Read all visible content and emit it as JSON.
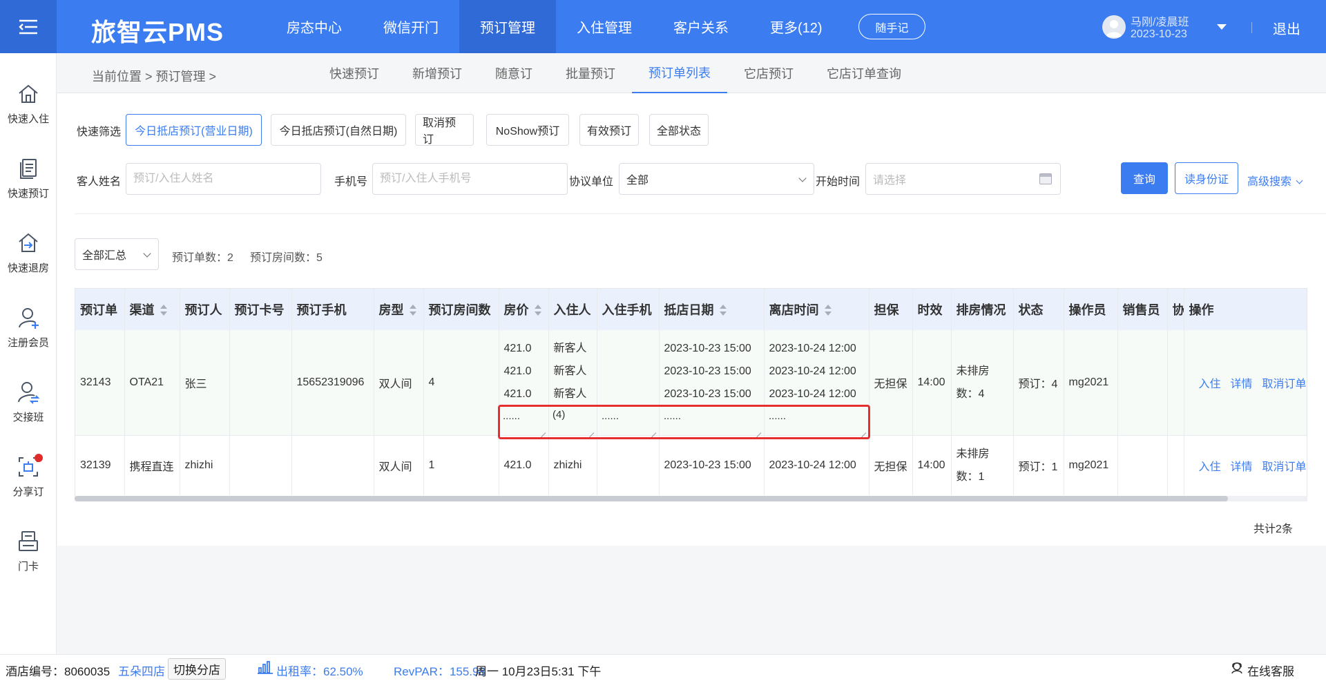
{
  "header": {
    "brand": "旅智云PMS",
    "nav": [
      "房态中心",
      "微信开门",
      "预订管理",
      "入住管理",
      "客户关系",
      "更多(12)"
    ],
    "active_nav": "预订管理",
    "memo_label": "随手记",
    "user_name": "马刚/凌晨班",
    "user_date": "2023-10-23",
    "logout_label": "退出",
    "accent_color": "#3b7cf0"
  },
  "sidebar": {
    "items": [
      {
        "label": "快速入住",
        "icon": "home-icon"
      },
      {
        "label": "快速预订",
        "icon": "document-icon"
      },
      {
        "label": "快速退房",
        "icon": "checkout-icon"
      },
      {
        "label": "注册会员",
        "icon": "add-user-icon"
      },
      {
        "label": "交接班",
        "icon": "handover-icon"
      },
      {
        "label": "分享订",
        "icon": "share-icon"
      },
      {
        "label": "门卡",
        "icon": "card-icon"
      }
    ]
  },
  "breadcrumb": {
    "text": "当前位置 > 预订管理 >"
  },
  "subnav": {
    "items": [
      "快速预订",
      "新增预订",
      "随意订",
      "批量预订",
      "预订单列表",
      "它店预订",
      "它店订单查询"
    ],
    "active": "预订单列表"
  },
  "filters": {
    "quick_label": "快速筛选",
    "quick_buttons": [
      "今日抵店预订(营业日期)",
      "今日抵店预订(自然日期)",
      "取消预订",
      "NoShow预订",
      "有效预订",
      "全部状态"
    ],
    "guest_label": "客人姓名",
    "guest_placeholder": "预订/入住人姓名",
    "phone_label": "手机号",
    "phone_placeholder": "预订/入住人手机号",
    "unit_label": "协议单位",
    "unit_value": "全部",
    "start_label": "开始时间",
    "start_placeholder": "请选择",
    "query_label": "查询",
    "id_read_label": "读身份证",
    "advanced_label": "高级搜索"
  },
  "summary": {
    "select_value": "全部汇总",
    "order_count_label": "预订单数：",
    "order_count": "2",
    "room_count_label": "预订房间数：",
    "room_count": "5"
  },
  "table": {
    "columns": [
      "预订单",
      "渠道",
      "预订人",
      "预订卡号",
      "预订手机",
      "房型",
      "预订房间数",
      "房价",
      "入住人",
      "入住手机",
      "抵店日期",
      "离店时间",
      "担保",
      "时效",
      "排房情况",
      "状态",
      "操作员",
      "销售员",
      "协",
      "操作"
    ],
    "rows": [
      {
        "id": "32143",
        "channel": "OTA21",
        "booker": "张三",
        "card": "",
        "phone": "15652319096",
        "room_type": "双人间",
        "rooms": "4",
        "prices": [
          "421.0",
          "421.0",
          "421.0"
        ],
        "price_more": "......",
        "guests": [
          "新客人",
          "新客人",
          "新客人"
        ],
        "guest_more": "(4)",
        "guest_phone_more": "......",
        "arrivals": [
          "2023-10-23 15:00",
          "2023-10-23 15:00",
          "2023-10-23 15:00"
        ],
        "arrival_more": "......",
        "departures": [
          "2023-10-24 12:00",
          "2023-10-24 12:00",
          "2023-10-24 12:00"
        ],
        "departure_more": "......",
        "guarantee": "无担保",
        "time": "14:00",
        "assign_l1": "未排房",
        "assign_l2": "数：4",
        "status": "预订：4",
        "operator": "mg2021",
        "sales": ""
      },
      {
        "id": "32139",
        "channel": "携程直连",
        "booker": "zhizhi",
        "card": "",
        "phone": "",
        "room_type": "双人间",
        "rooms": "1",
        "price": "421.0",
        "guest": "zhizhi",
        "guest_phone": "",
        "arrival": "2023-10-23 15:00",
        "departure": "2023-10-24 12:00",
        "guarantee": "无担保",
        "time": "14:00",
        "assign_l1": "未排房",
        "assign_l2": "数：1",
        "status": "预订：1",
        "operator": "mg2021",
        "sales": ""
      }
    ],
    "actions": [
      "入住",
      "详情",
      "取消订单"
    ],
    "total": "共计2条"
  },
  "footer": {
    "hotel_label": "酒店编号：",
    "hotel_id": "8060035",
    "hotel_name": "五朵四店",
    "switch_label": "切换分店",
    "occupancy_label": "出租率：",
    "occupancy": "62.50%",
    "revpar_label": "RevPAR：",
    "revpar": "155.98",
    "datetime": "周一 10月23日5:31 下午",
    "support_label": "在线客服"
  }
}
